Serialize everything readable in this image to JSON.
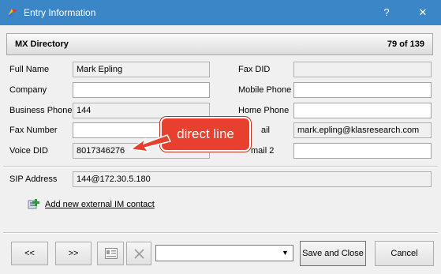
{
  "window": {
    "title": "Entry Information",
    "help_glyph": "?",
    "close_glyph": "✕"
  },
  "header": {
    "title": "MX Directory",
    "count": "79 of 139"
  },
  "left_fields": [
    {
      "label": "Full Name",
      "value": "Mark  Epling",
      "readonly": true
    },
    {
      "label": "Company",
      "value": "",
      "readonly": false
    },
    {
      "label": "Business Phone",
      "value": "144",
      "readonly": true
    },
    {
      "label": "Fax Number",
      "value": "",
      "readonly": false
    },
    {
      "label": "Voice DID",
      "value": "8017346276",
      "readonly": true
    }
  ],
  "right_fields": [
    {
      "label": "Fax DID",
      "value": "",
      "readonly": true
    },
    {
      "label": "Mobile Phone",
      "value": "",
      "readonly": false
    },
    {
      "label": "Home Phone",
      "value": "",
      "readonly": false
    },
    {
      "label": "E-mail",
      "visible_label": "ail",
      "value": "mark.epling@klasresearch.com",
      "readonly": true
    },
    {
      "label": "E-mail 2",
      "visible_label": "mail 2",
      "value": "",
      "readonly": false
    }
  ],
  "sip": {
    "label": "SIP Address",
    "value": "144@172.30.5.180"
  },
  "im_link": {
    "label": "Add new external IM contact"
  },
  "callout": {
    "text": "direct line",
    "color": "#e7402f"
  },
  "footer": {
    "prev_label": "<<",
    "next_label": ">>",
    "dropdown_value": "",
    "save_label": "Save and Close",
    "cancel_label": "Cancel"
  },
  "colors": {
    "titlebar": "#3a86c7",
    "accent": "#e7402f"
  }
}
